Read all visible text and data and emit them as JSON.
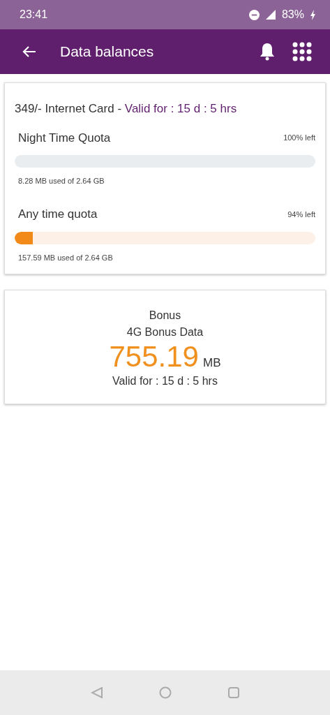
{
  "status_bar": {
    "time": "23:41",
    "battery": "83%"
  },
  "app_bar": {
    "title": "Data balances"
  },
  "plan": {
    "title": "349/- Internet Card - ",
    "validity": "Valid for : 15 d : 5 hrs",
    "quotas": [
      {
        "name": "Night Time Quota",
        "left": "100% left",
        "level": 0,
        "usage": "8.28 MB used of 2.64 GB"
      },
      {
        "name": "Any time quota",
        "left": "94% left",
        "level": 0.06,
        "usage": "157.59 MB used of 2.64 GB"
      }
    ]
  },
  "bonus": {
    "title": "Bonus",
    "subtitle": "4G Bonus Data",
    "amount": "755.19",
    "unit": "MB",
    "validity": "Valid for : 15 d : 5 hrs"
  }
}
